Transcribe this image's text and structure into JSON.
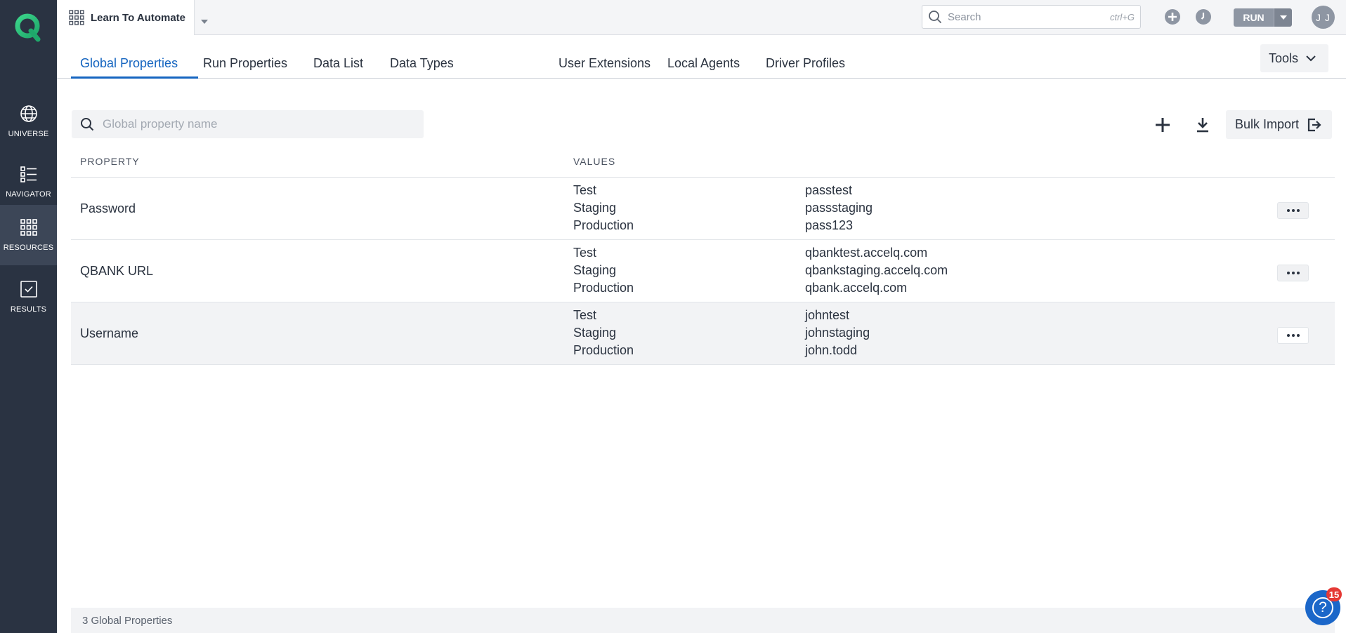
{
  "sidebar": {
    "logo_icon": "accelq-logo",
    "items": [
      {
        "label": "UNIVERSE",
        "icon": "globe-icon"
      },
      {
        "label": "NAVIGATOR",
        "icon": "list-icon"
      },
      {
        "label": "RESOURCES",
        "icon": "grid-icon"
      },
      {
        "label": "RESULTS",
        "icon": "checkbox-icon"
      }
    ],
    "active": "RESOURCES"
  },
  "header": {
    "project_name": "Learn To Automate",
    "search": {
      "placeholder": "Search",
      "shortcut": "ctrl+G"
    },
    "run_label": "RUN",
    "user_initials": "J J"
  },
  "tabs": {
    "items": [
      "Global Properties",
      "Run Properties",
      "Data List",
      "Data Types",
      "User Extensions",
      "Local Agents",
      "Driver Profiles"
    ],
    "active": "Global Properties",
    "tools_label": "Tools"
  },
  "toolbar": {
    "filter_placeholder": "Global property name",
    "bulk_import_label": "Bulk Import"
  },
  "table": {
    "columns": {
      "property": "PROPERTY",
      "values": "VALUES"
    },
    "rows": [
      {
        "property": "Password",
        "values": [
          {
            "env": "Test",
            "value": "passtest"
          },
          {
            "env": "Staging",
            "value": "passstaging"
          },
          {
            "env": "Production",
            "value": "pass123"
          }
        ]
      },
      {
        "property": "QBANK URL",
        "values": [
          {
            "env": "Test",
            "value": "qbanktest.accelq.com"
          },
          {
            "env": "Staging",
            "value": "qbankstaging.accelq.com"
          },
          {
            "env": "Production",
            "value": "qbank.accelq.com"
          }
        ]
      },
      {
        "property": "Username",
        "values": [
          {
            "env": "Test",
            "value": "johntest"
          },
          {
            "env": "Staging",
            "value": "johnstaging"
          },
          {
            "env": "Production",
            "value": "john.todd"
          }
        ]
      }
    ]
  },
  "footer": {
    "count_text": "3 Global Properties"
  },
  "help": {
    "badge_count": "15"
  },
  "colors": {
    "accent": "#1565c0",
    "sidebar": "#2a3342",
    "badge": "#e53935"
  }
}
